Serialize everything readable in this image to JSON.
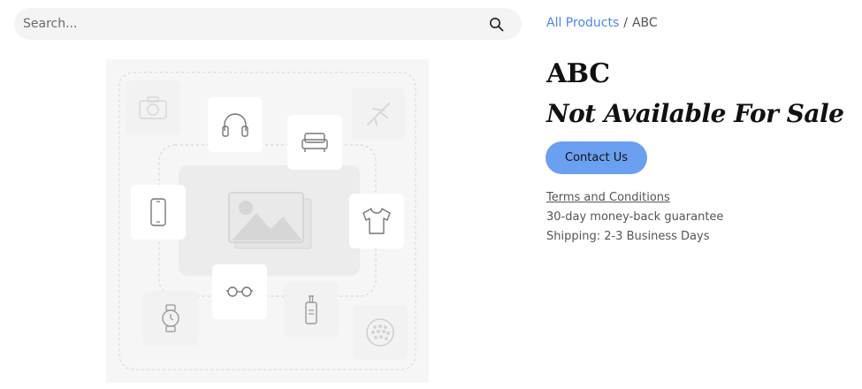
{
  "search": {
    "placeholder": "Search..."
  },
  "breadcrumb": {
    "parent": "All Products",
    "separator": "/",
    "current": "ABC"
  },
  "product": {
    "title": "ABC",
    "sale_status": "Not Available For Sale",
    "contact_label": "Contact Us"
  },
  "info": {
    "terms_label": "Terms and Conditions",
    "guarantee": "30-day money-back guarantee",
    "shipping": "Shipping: 2-3 Business Days"
  },
  "placeholder_icons": [
    "camera-icon",
    "headphones-icon",
    "sofa-icon",
    "airplane-icon",
    "smartphone-icon",
    "image-icon",
    "tshirt-icon",
    "watch-icon",
    "glasses-icon",
    "bottle-icon",
    "golf-ball-icon"
  ],
  "colors": {
    "accent": "#6ba0f0",
    "link": "#4a86e8",
    "search_bg": "#f4f4f5"
  }
}
